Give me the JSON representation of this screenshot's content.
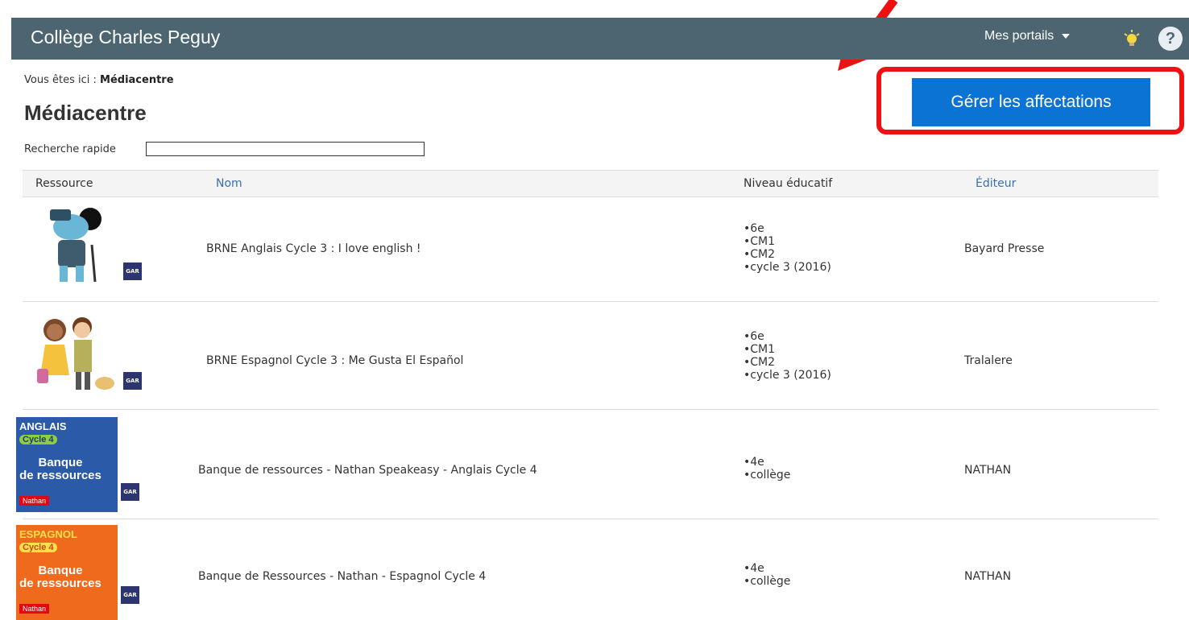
{
  "header": {
    "title": "Collège Charles Peguy",
    "portals_label": "Mes portails",
    "help_label": "?"
  },
  "breadcrumb": {
    "prefix": "Vous êtes ici :",
    "current": "Médiacentre"
  },
  "page_title": "Médiacentre",
  "search": {
    "label": "Recherche rapide",
    "value": ""
  },
  "manage_button": "Gérer les affectations",
  "table": {
    "columns": [
      "Ressource",
      "Nom",
      "Niveau éducatif",
      "Éditeur"
    ],
    "rows": [
      {
        "name": "BRNE Anglais Cycle 3 : I love english !",
        "levels": [
          "6e",
          "CM1",
          "CM2",
          "cycle 3 (2016)"
        ],
        "editor": "Bayard Presse",
        "badge": "GAR"
      },
      {
        "name": "BRNE Espagnol Cycle 3 : Me Gusta El Español",
        "levels": [
          "6e",
          "CM1",
          "CM2",
          "cycle 3 (2016)"
        ],
        "editor": "Tralalere",
        "badge": "GAR"
      },
      {
        "name": "Banque de ressources - Nathan Speakeasy - Anglais Cycle 4",
        "levels": [
          "4e",
          "collège"
        ],
        "editor": "NATHAN",
        "badge": "GAR",
        "cover": {
          "subject": "ANGLAIS",
          "cycle": "Cycle 4",
          "title_1": "Banque",
          "title_2": "de ressources",
          "brand": "Nathan"
        }
      },
      {
        "name": "Banque de Ressources - Nathan - Espagnol Cycle 4",
        "levels": [
          "4e",
          "collège"
        ],
        "editor": "NATHAN",
        "badge": "GAR",
        "cover": {
          "subject": "ESPAGNOL",
          "cycle": "Cycle 4",
          "title_1": "Banque",
          "title_2": "de ressources",
          "brand": "Nathan"
        }
      }
    ]
  },
  "colors": {
    "topbar": "#4d6570",
    "button": "#0b73d4",
    "highlight": "#ee1111",
    "link": "#3a6fb0",
    "anglais_cover": "#2a5aa8",
    "espagnol_cover": "#f06a1e"
  },
  "icons": [
    "lightbulb-icon",
    "help-icon",
    "caret-down-icon",
    "red-arrow-icon"
  ]
}
